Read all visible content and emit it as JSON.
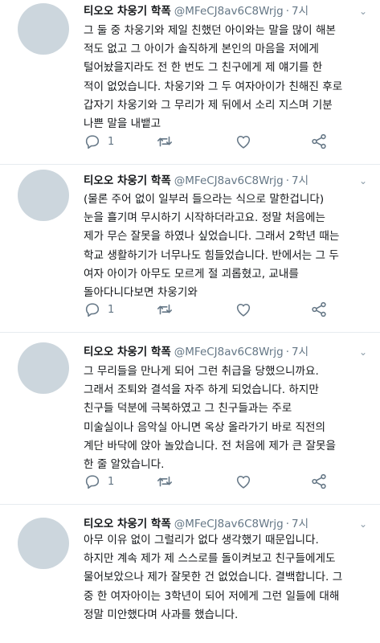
{
  "tweets": [
    {
      "name": "티오오 차웅기 학폭",
      "handle": "@MFeCJ8av6C8Wrjg",
      "dot": "·",
      "time": "7시",
      "lines": [
        "그 둘 중 차웅기와 제일 친했던 아이와는 말을 많이 해본",
        "적도 없고 그 아이가 솔직하게 본인의 마음을 저에게",
        "털어놨을지라도 전 한 번도 그 친구에게 제 얘기를 한",
        "적이 없었습니다. 차웅기와 그 두 여자아이가 친해진 후로",
        "갑자기 차웅기와 그 무리가 제 뒤에서 소리 지스며 기분",
        "나쁜 말을 내뱉고"
      ],
      "reply_count": "1",
      "retweet_count": "",
      "like_count": ""
    },
    {
      "name": "티오오 차웅기 학폭",
      "handle": "@MFeCJ8av6C8Wrjg",
      "dot": "·",
      "time": "7시",
      "lines": [
        "(물론 주어 없이 일부러 들으라는 식으로 말한겁니다)",
        "눈을 흘기며 무시하기 시작하더라고요. 정말 처음에는",
        "제가 무슨 잘못을 하였나 싶었습니다. 그래서 2학년 때는",
        "학교 생활하기가 너무나도 힘들었습니다. 반에서는 그 두",
        "여자 아이가 아무도 모르게 절 괴롭혔고, 교내를",
        "돌아다니다보면 차웅기와"
      ],
      "reply_count": "1",
      "retweet_count": "",
      "like_count": ""
    },
    {
      "name": "티오오 차웅기 학폭",
      "handle": "@MFeCJ8av6C8Wrjg",
      "dot": "·",
      "time": "7시",
      "lines": [
        "그 무리들을 만나게 되어 그런 취급을 당했으니까요.",
        "그래서 조퇴와 결석을 자주 하게 되었습니다. 하지만",
        "친구들 덕분에 극복하였고 그 친구들과는 주로",
        "미술실이나 음악실 아니면 옥상 올라가기 바로 직전의",
        "계단 바닥에 앉아 놀았습니다. 전 처음에 제가 큰 잘못을",
        "한 줄 알았습니다."
      ],
      "reply_count": "1",
      "retweet_count": "",
      "like_count": ""
    },
    {
      "name": "티오오 차웅기 학폭",
      "handle": "@MFeCJ8av6C8Wrjg",
      "dot": "·",
      "time": "7시",
      "lines": [
        "아무 이유 없이 그럴리가 없다 생각했기 때문입니다.",
        "하지만 계속 제가 제 스스로를 돌이켜보고 친구들에게도",
        "물어보았으나 제가 잘못한 건 없었습니다. 결백합니다. 그",
        "중 한 여자아이는 3학년이 되어 저에게 그런 일들에 대해",
        "정말 미안했다며 사과를 했습니다."
      ],
      "reply_count": "",
      "retweet_count": "",
      "like_count": ""
    }
  ]
}
